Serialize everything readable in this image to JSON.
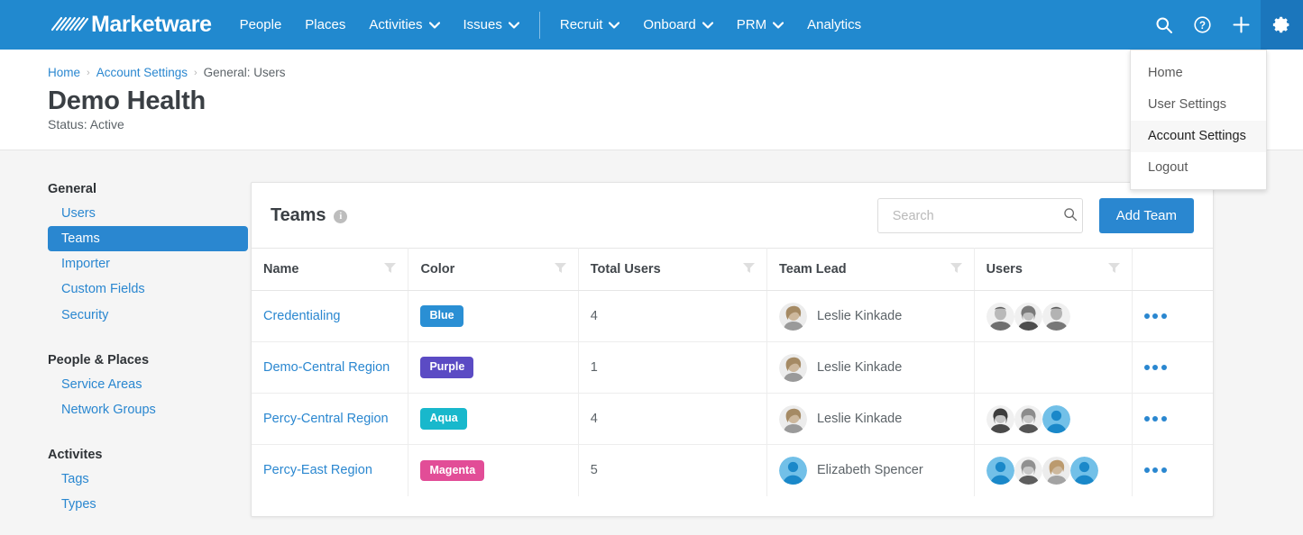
{
  "nav": {
    "brand": "Marketware",
    "brand_mark_icon": "stripes-logo-icon",
    "items": [
      {
        "label": "People",
        "caret": false
      },
      {
        "label": "Places",
        "caret": false
      },
      {
        "label": "Activities",
        "caret": true
      },
      {
        "label": "Issues",
        "caret": true
      },
      {
        "label": "Recruit",
        "caret": true
      },
      {
        "label": "Onboard",
        "caret": true
      },
      {
        "label": "PRM",
        "caret": true
      },
      {
        "label": "Analytics",
        "caret": false
      }
    ],
    "right_icons": [
      {
        "name": "search-icon"
      },
      {
        "name": "help-icon"
      },
      {
        "name": "add-icon"
      },
      {
        "name": "gear-icon"
      }
    ],
    "bg_color": "#2189cf",
    "active_icon_bg": "#1b76bc"
  },
  "dropdown": {
    "items": [
      {
        "label": "Home",
        "highlighted": false
      },
      {
        "label": "User Settings",
        "highlighted": false
      },
      {
        "label": "Account Settings",
        "highlighted": true
      },
      {
        "label": "Logout",
        "highlighted": false
      }
    ]
  },
  "header": {
    "breadcrumb": [
      {
        "label": "Home",
        "link": true
      },
      {
        "label": "Account Settings",
        "link": true
      },
      {
        "label": "General: Users",
        "link": false
      }
    ],
    "separator": "›",
    "title": "Demo Health",
    "status": "Status: Active"
  },
  "sidebar": {
    "groups": [
      {
        "title": "General",
        "items": [
          {
            "label": "Users",
            "active": false
          },
          {
            "label": "Teams",
            "active": true
          },
          {
            "label": "Importer",
            "active": false
          },
          {
            "label": "Custom Fields",
            "active": false
          },
          {
            "label": "Security",
            "active": false
          }
        ]
      },
      {
        "title": "People & Places",
        "items": [
          {
            "label": "Service Areas",
            "active": false
          },
          {
            "label": "Network Groups",
            "active": false
          }
        ]
      },
      {
        "title": "Activites",
        "items": [
          {
            "label": "Tags",
            "active": false
          },
          {
            "label": "Types",
            "active": false
          }
        ]
      }
    ]
  },
  "card": {
    "title": "Teams",
    "info_icon": "info-icon",
    "search": {
      "placeholder": "Search",
      "value": "",
      "icon": "search-icon"
    },
    "add_button": "Add Team",
    "accent_color": "#2a87d0"
  },
  "table": {
    "columns": [
      {
        "label": "Name",
        "filter": true
      },
      {
        "label": "Color",
        "filter": true
      },
      {
        "label": "Total Users",
        "filter": true
      },
      {
        "label": "Team Lead",
        "filter": true
      },
      {
        "label": "Users",
        "filter": true
      },
      {
        "label": "",
        "filter": false
      }
    ],
    "rows": [
      {
        "name": "Credentialing",
        "color_label": "Blue",
        "color_hex": "#2a8fd4",
        "total_users": "4",
        "team_lead": "Leslie Kinkade",
        "lead_avatar": "photo-female-1",
        "users_avatars": [
          "photo-male-1",
          "photo-female-2",
          "photo-male-2"
        ],
        "actions_icon": "more-options-icon"
      },
      {
        "name": "Demo-Central Region",
        "color_label": "Purple",
        "color_hex": "#5b4bc4",
        "total_users": "1",
        "team_lead": "Leslie Kinkade",
        "lead_avatar": "photo-female-1",
        "users_avatars": [],
        "actions_icon": "more-options-icon"
      },
      {
        "name": "Percy-Central Region",
        "color_label": "Aqua",
        "color_hex": "#18b8cc",
        "total_users": "4",
        "team_lead": "Leslie Kinkade",
        "lead_avatar": "photo-female-1",
        "users_avatars": [
          "photo-female-3",
          "photo-female-4",
          "placeholder-avatar"
        ],
        "actions_icon": "more-options-icon"
      },
      {
        "name": "Percy-East Region",
        "color_label": "Magenta",
        "color_hex": "#e24d97",
        "total_users": "5",
        "team_lead": "Elizabeth Spencer",
        "lead_avatar": "placeholder-avatar",
        "users_avatars": [
          "placeholder-avatar",
          "photo-female-4",
          "photo-female-1",
          "placeholder-avatar"
        ],
        "actions_icon": "more-options-icon"
      }
    ]
  }
}
